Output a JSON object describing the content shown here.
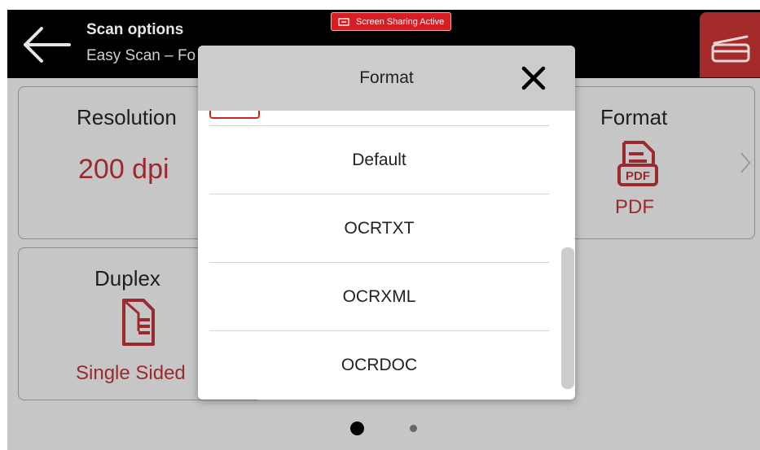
{
  "header": {
    "title": "Scan options",
    "subtitle": "Easy Scan – Fo",
    "back_icon": "arrow-left-icon",
    "scan_icon": "scanner-icon"
  },
  "banner": {
    "label": "Screen Sharing Active",
    "icon": "screen-share-icon"
  },
  "tiles": {
    "resolution": {
      "label": "Resolution",
      "value": "200 dpi"
    },
    "format": {
      "label": "Format",
      "value": "PDF",
      "icon": "pdf-file-icon",
      "icon_text": "PDF"
    },
    "duplex": {
      "label": "Duplex",
      "value": "Single Sided",
      "icon": "single-page-icon"
    }
  },
  "pagination": {
    "current_page": 1,
    "total_pages": 2
  },
  "modal": {
    "title": "Format",
    "close_icon": "close-icon",
    "options": [
      "Default",
      "OCRTXT",
      "OCRXML",
      "OCRDOC"
    ]
  },
  "colors": {
    "accent_red": "#9b2a2e",
    "banner_red": "#d81e25",
    "scan_button": "#a52a2a",
    "dim_background": "#c6c6c6",
    "topbar": "#000000"
  }
}
